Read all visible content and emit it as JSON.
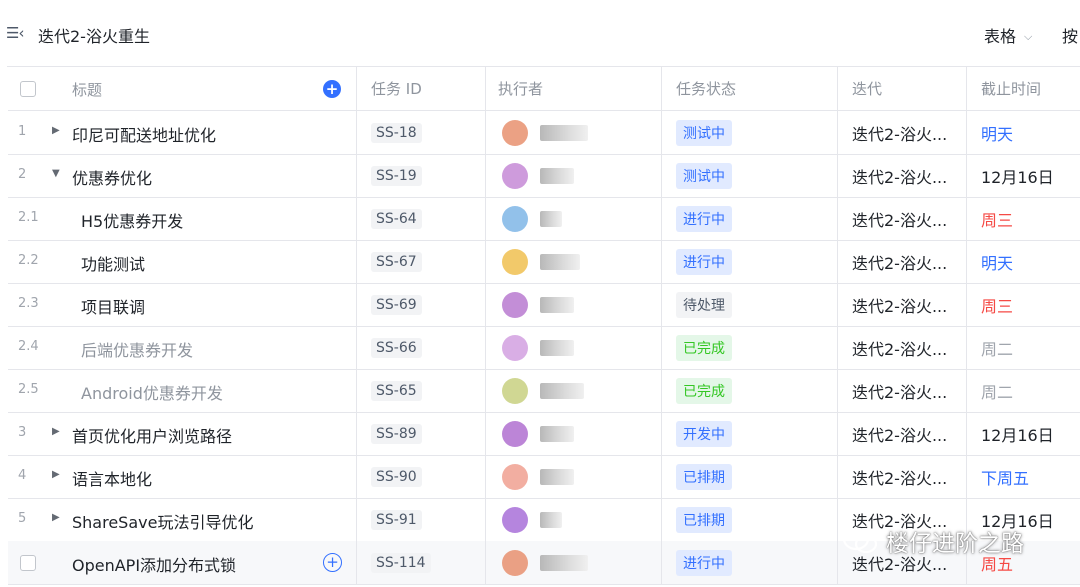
{
  "header": {
    "menu_icon": "☰‹",
    "title": "迭代2-浴火重生",
    "view_label": "表格",
    "cut_button": "按"
  },
  "columns": {
    "title": "标题",
    "task_id": "任务 ID",
    "assignee": "执行者",
    "status": "任务状态",
    "sprint": "迭代",
    "due": "截止时间"
  },
  "rows": [
    {
      "num": "1",
      "toggle": "▶",
      "title": "印尼可配送地址优化",
      "id": "SS-18",
      "status": "测试中",
      "sprint": "迭代2-浴火...",
      "due": "明天"
    },
    {
      "num": "2",
      "toggle": "▼",
      "title": "优惠券优化",
      "id": "SS-19",
      "status": "测试中",
      "sprint": "迭代2-浴火...",
      "due": "12月16日"
    },
    {
      "num": "2.1",
      "toggle": "",
      "title": "H5优惠券开发",
      "id": "SS-64",
      "status": "进行中",
      "sprint": "迭代2-浴火...",
      "due": "周三"
    },
    {
      "num": "2.2",
      "toggle": "",
      "title": "功能测试",
      "id": "SS-67",
      "status": "进行中",
      "sprint": "迭代2-浴火...",
      "due": "明天"
    },
    {
      "num": "2.3",
      "toggle": "",
      "title": "项目联调",
      "id": "SS-69",
      "status": "待处理",
      "sprint": "迭代2-浴火...",
      "due": "周三"
    },
    {
      "num": "2.4",
      "toggle": "",
      "title": "后端优惠券开发",
      "id": "SS-66",
      "status": "已完成",
      "sprint": "迭代2-浴火...",
      "due": "周二"
    },
    {
      "num": "2.5",
      "toggle": "",
      "title": "Android优惠券开发",
      "id": "SS-65",
      "status": "已完成",
      "sprint": "迭代2-浴火...",
      "due": "周二"
    },
    {
      "num": "3",
      "toggle": "▶",
      "title": "首页优化用户浏览路径",
      "id": "SS-89",
      "status": "开发中",
      "sprint": "迭代2-浴火...",
      "due": "12月16日"
    },
    {
      "num": "4",
      "toggle": "▶",
      "title": "语言本地化",
      "id": "SS-90",
      "status": "已排期",
      "sprint": "迭代2-浴火...",
      "due": "下周五"
    },
    {
      "num": "5",
      "toggle": "▶",
      "title": "ShareSave玩法引导优化",
      "id": "SS-91",
      "status": "已排期",
      "sprint": "迭代2-浴火...",
      "due": "12月16日"
    }
  ],
  "new_row": {
    "title": "OpenAPI添加分布式锁",
    "id": "SS-114",
    "status": "进行中",
    "sprint": "迭代2-浴火...",
    "due": "周五"
  },
  "watermark": {
    "text": "楼仔进阶之路"
  },
  "colors": {
    "accent": "#3370ff",
    "danger": "#f54a45",
    "success": "#34c724",
    "border": "#e5e6eb"
  }
}
